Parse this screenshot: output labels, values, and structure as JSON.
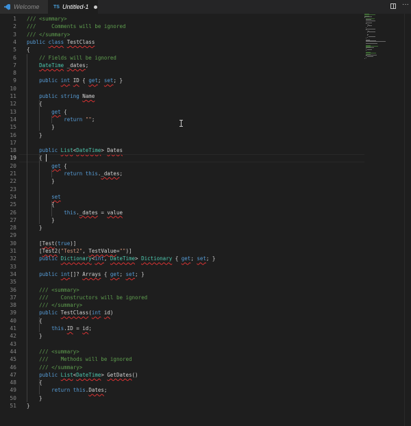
{
  "tabs": [
    {
      "label": "Welcome",
      "icon": "vscode-logo-icon",
      "active": false
    },
    {
      "label": "Untitled-1",
      "icon_text": "TS",
      "active": true,
      "dirty": true
    }
  ],
  "toolbar": {
    "split_icon": "split-editor-icon",
    "more_icon": "more-actions-icon",
    "more_glyph": "···"
  },
  "editor": {
    "current_line": 19,
    "lines": [
      "/// <summary>",
      "///     Comments will be ignored",
      "/// </summary>",
      "public class TestClass",
      "{",
      "    // Fields will be ignored",
      "    DateTime _dates;",
      "",
      "    public int ID { get; set; }",
      "",
      "    public string Name",
      "    {",
      "        get {",
      "            return \"\";",
      "        }",
      "    }",
      "",
      "    public List<DateTime> Dates",
      "    {",
      "        get {",
      "            return this._dates;",
      "        }",
      "",
      "        set",
      "        {",
      "            this._dates = value",
      "        }",
      "    }",
      "",
      "    [Test(true)]",
      "    [Test2(\"Test2\", TestValue=\"\")]",
      "    public Dictionary<int, DateTime> Dictionary { get; set; }",
      "",
      "    public int[]? Arrays { get; set; }",
      "",
      "    /// <summary>",
      "    ///    Constructors will be ignored",
      "    /// </summary>",
      "    public TestClass(int id)",
      "    {",
      "        this.ID = id;",
      "    }",
      "",
      "    /// <summary>",
      "    ///    Methods will be ignored",
      "    /// </summary>",
      "    public List<DateTime> GetDates()",
      "    {",
      "        return this.Dates;",
      "    }",
      "}"
    ]
  },
  "colors": {
    "background": "#1e1e1e",
    "comment": "#5f9e4f",
    "keyword": "#569cd6",
    "type": "#4ec9b0",
    "string": "#ce9178",
    "text": "#d4d4d4",
    "line_number": "#858585"
  }
}
